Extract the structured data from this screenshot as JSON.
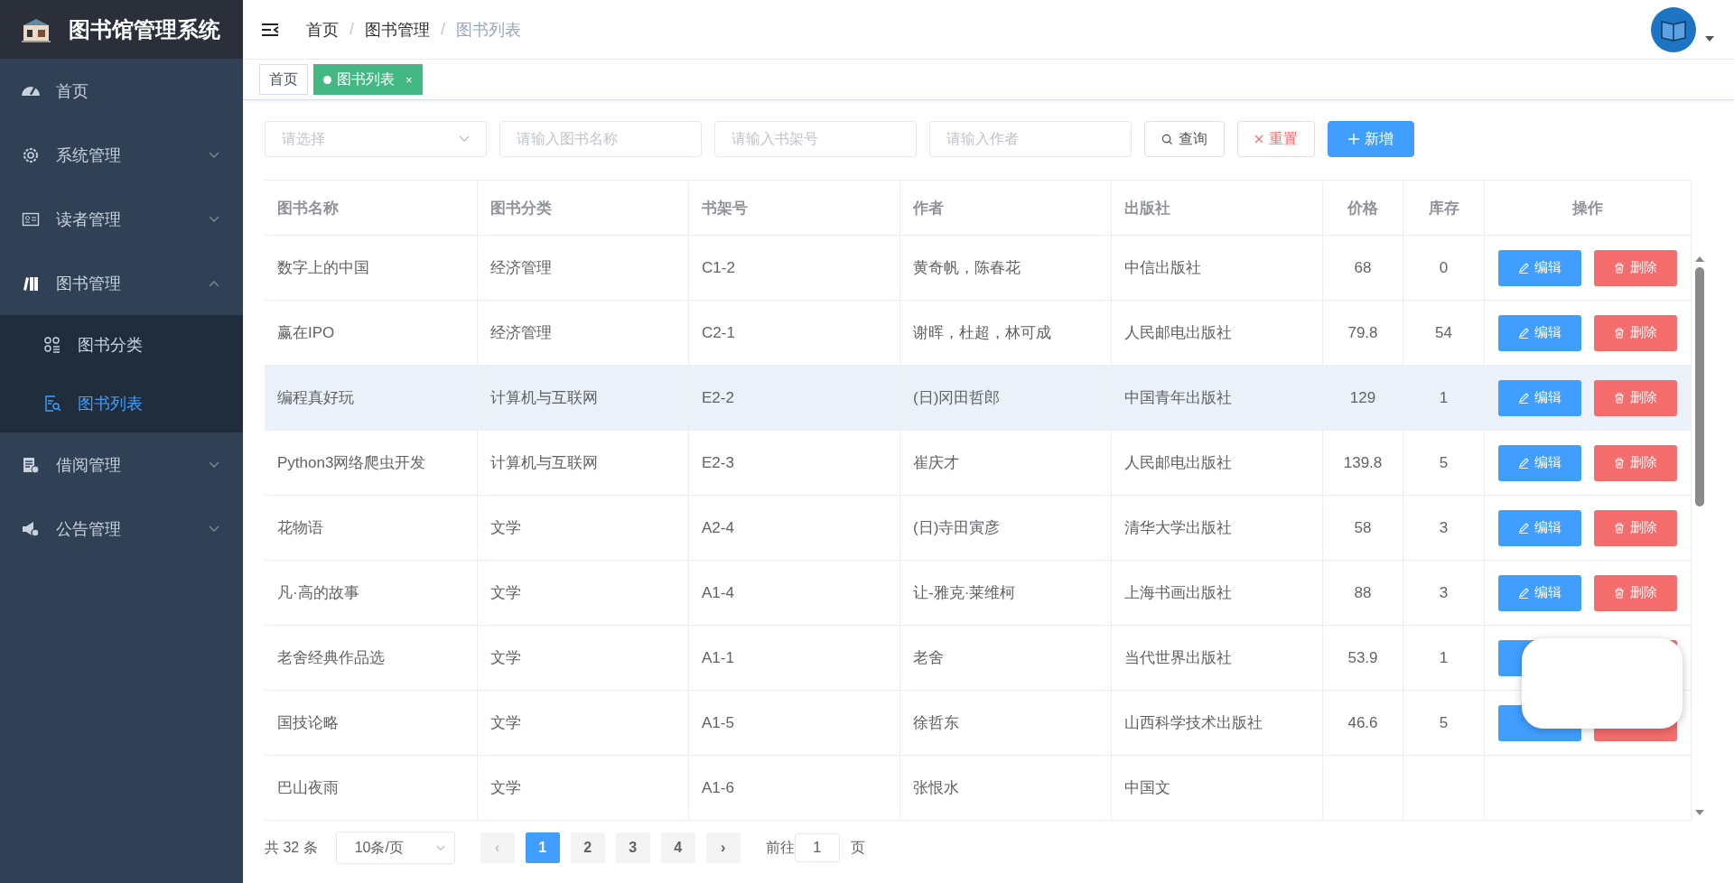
{
  "app": {
    "title": "图书馆管理系统"
  },
  "sidebar": {
    "items": [
      {
        "label": "首页"
      },
      {
        "label": "系统管理",
        "expanded": false
      },
      {
        "label": "读者管理",
        "expanded": false
      },
      {
        "label": "图书管理",
        "expanded": true,
        "children": [
          {
            "label": "图书分类",
            "selected": false
          },
          {
            "label": "图书列表",
            "selected": true
          }
        ]
      },
      {
        "label": "借阅管理",
        "expanded": false
      },
      {
        "label": "公告管理",
        "expanded": false
      }
    ]
  },
  "breadcrumb": {
    "separator": "/",
    "items": [
      "首页",
      "图书管理",
      "图书列表"
    ]
  },
  "tags": [
    {
      "label": "首页",
      "selected": false
    },
    {
      "label": "图书列表",
      "selected": true,
      "close": "×"
    }
  ],
  "filters": {
    "category": {
      "placeholder": "请选择"
    },
    "name": {
      "placeholder": "请输入图书名称"
    },
    "shelf": {
      "placeholder": "请输入书架号"
    },
    "author": {
      "placeholder": "请输入作者"
    },
    "buttons": [
      {
        "kind": "search",
        "label": "查询"
      },
      {
        "kind": "reset",
        "label": "重置"
      },
      {
        "kind": "add",
        "label": "新增"
      }
    ]
  },
  "table": {
    "columns": [
      "图书名称",
      "图书分类",
      "书架号",
      "作者",
      "出版社",
      "价格",
      "库存",
      "操作"
    ],
    "rows": [
      {
        "cells": [
          "数字上的中国",
          "经济管理",
          "C1-2",
          "黄奇帆，陈春花",
          "中信出版社",
          "68",
          "0"
        ],
        "actions": [
          {
            "kind": "edit",
            "label": "编辑"
          },
          {
            "kind": "delete",
            "label": "删除"
          }
        ],
        "hovered": false
      },
      {
        "cells": [
          "赢在IPO",
          "经济管理",
          "C2-1",
          "谢晖，杜超，林可成",
          "人民邮电出版社",
          "79.8",
          "54"
        ],
        "actions": [
          {
            "kind": "edit",
            "label": "编辑"
          },
          {
            "kind": "delete",
            "label": "删除"
          }
        ],
        "hovered": false
      },
      {
        "cells": [
          "编程真好玩",
          "计算机与互联网",
          "E2-2",
          "(日)冈田哲郎",
          "中国青年出版社",
          "129",
          "1"
        ],
        "actions": [
          {
            "kind": "edit",
            "label": "编辑"
          },
          {
            "kind": "delete",
            "label": "删除"
          }
        ],
        "hovered": true
      },
      {
        "cells": [
          "Python3网络爬虫开发",
          "计算机与互联网",
          "E2-3",
          "崔庆才",
          "人民邮电出版社",
          "139.8",
          "5"
        ],
        "actions": [
          {
            "kind": "edit",
            "label": "编辑"
          },
          {
            "kind": "delete",
            "label": "删除"
          }
        ],
        "hovered": false
      },
      {
        "cells": [
          "花物语",
          "文学",
          "A2-4",
          "(日)寺田寅彦",
          "清华大学出版社",
          "58",
          "3"
        ],
        "actions": [
          {
            "kind": "edit",
            "label": "编辑"
          },
          {
            "kind": "delete",
            "label": "删除"
          }
        ],
        "hovered": false
      },
      {
        "cells": [
          "凡·高的故事",
          "文学",
          "A1-4",
          "让-雅克·莱维柯",
          "上海书画出版社",
          "88",
          "3"
        ],
        "actions": [
          {
            "kind": "edit",
            "label": "编辑"
          },
          {
            "kind": "delete",
            "label": "删除"
          }
        ],
        "hovered": false
      },
      {
        "cells": [
          "老舍经典作品选",
          "文学",
          "A1-1",
          "老舍",
          "当代世界出版社",
          "53.9",
          "1"
        ],
        "actions": [
          {
            "kind": "edit"
          },
          {
            "kind": "delete"
          }
        ],
        "hovered": false
      },
      {
        "cells": [
          "国技论略",
          "文学",
          "A1-5",
          "徐哲东",
          "山西科学技术出版社",
          "46.6",
          "5"
        ],
        "actions": [
          {
            "kind": "edit"
          },
          {
            "kind": "delete"
          }
        ],
        "hovered": false
      },
      {
        "cells": [
          "巴山夜雨",
          "文学",
          "A1-6",
          "张恨水",
          "中国文"
        ],
        "hovered": false
      }
    ]
  },
  "overlay": {
    "kind": "blank-card"
  },
  "pagination": {
    "total": "共 32 条",
    "page_size": "10条/页",
    "prev": "‹",
    "next": "›",
    "pages": [
      {
        "label": "1",
        "selected": true
      },
      {
        "label": "2",
        "selected": false
      },
      {
        "label": "3",
        "selected": false
      },
      {
        "label": "4",
        "selected": false
      }
    ],
    "goto_label": "前往",
    "goto_value": "1",
    "goto_suffix": "页"
  }
}
